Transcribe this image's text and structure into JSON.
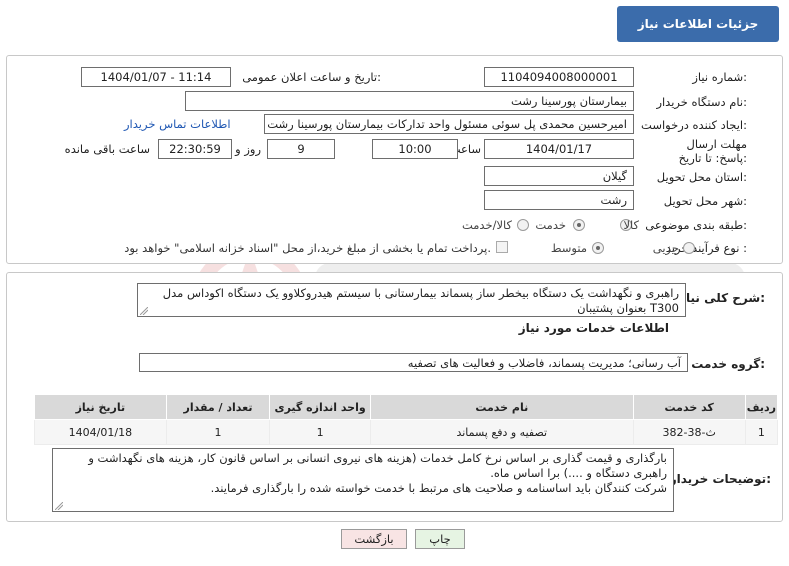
{
  "header": {
    "title": "جزئیات اطلاعات نیاز"
  },
  "fields": {
    "need_number_label": "شماره نیاز:",
    "need_number": "1104094008000001",
    "announce_label": "تاریخ و ساعت اعلان عمومی:",
    "announce_value": "1404/01/07 - 11:14",
    "buyer_label": "نام دستگاه خریدار:",
    "buyer_value": "بیمارستان پورسینا رشت",
    "creator_label": "ایجاد کننده درخواست:",
    "creator_value": "امیرحسین محمدی پل سوئی مسئول واحد تدارکات بیمارستان پورسینا رشت",
    "contact_link": "اطلاعات تماس خریدار",
    "deadline_label": "مهلت ارسال پاسخ: تا تاریخ:",
    "deadline_date": "1404/01/17",
    "time_label": "ساعت",
    "deadline_time": "10:00",
    "days_value": "9",
    "days_label": "روز و",
    "remaining_time": "22:30:59",
    "remaining_label": "ساعت باقی مانده",
    "province_label": "استان محل تحویل:",
    "province_value": "گیلان",
    "city_label": "شهر محل تحویل:",
    "city_value": "رشت",
    "category_label": "طبقه بندی موضوعی:",
    "category_options": [
      "کالا",
      "خدمت",
      "کالا/خدمت"
    ],
    "category_selected": "خدمت",
    "process_label": "نوع فرآیند خرید :",
    "process_options": [
      "جزیی",
      "متوسط"
    ],
    "process_selected": "متوسط",
    "treasury_note": "پرداخت تمام یا بخشی از مبلغ خرید،از محل \"اسناد خزانه اسلامی\" خواهد بود."
  },
  "summary": {
    "label": "شرح کلی نیاز:",
    "text": "راهبری و نگهداشت یک دستگاه بیخطر ساز پسماند بیمارستانی با سیستم هیدروکلاوو یک دستگاه اکوداس مدل T300 بعنوان پشتیبان"
  },
  "services": {
    "section_title": "اطلاعات خدمات مورد نیاز",
    "group_label": "گروه خدمت:",
    "group_value": "آب رسانی؛ مدیریت پسماند، فاضلاب و فعالیت های تصفیه",
    "columns": [
      "ردیف",
      "کد خدمت",
      "نام خدمت",
      "واحد اندازه گیری",
      "تعداد / مقدار",
      "تاریخ نیاز"
    ],
    "rows": [
      [
        "1",
        "ث-38-382",
        "تصفیه و دفع پسماند",
        "1",
        "1",
        "1404/01/18"
      ]
    ]
  },
  "buyer_notes": {
    "label": "توضیحات خریدار:",
    "lines": [
      "بارگذاری و قیمت گذاری بر اساس نرخ کامل خدمات (هزینه های نیروی انسانی بر اساس قانون کار، هزینه های نگهداشت و",
      "راهبری دستگاه و ....) برا اساس ماه.",
      "شرکت کنندگان باید اساسنامه و صلاحیت های مرتبط با خدمت خواسته شده را بارگذاری فرمایند."
    ]
  },
  "buttons": {
    "print": "چاپ",
    "back": "بازگشت"
  },
  "colors": {
    "header_bg": "#3b6cab",
    "link": "#1f57b3",
    "print_bg": "#e6f4e3",
    "back_bg": "#f8e4e4"
  }
}
